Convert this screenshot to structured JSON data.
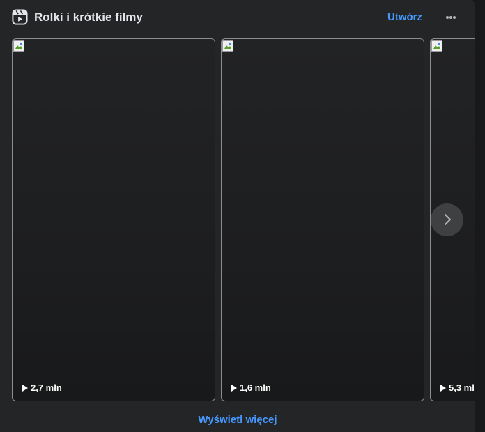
{
  "section": {
    "title": "Rolki i krótkie filmy",
    "icon": "reels-icon",
    "create_label": "Utwórz",
    "more_icon": "more-options-icon",
    "see_more_label": "Wyświetl więcej",
    "next_icon": "chevron-right-icon"
  },
  "reels": [
    {
      "views": "2,7 mln"
    },
    {
      "views": "1,6 mln"
    },
    {
      "views": "5,3 mln"
    }
  ],
  "colors": {
    "background": "#242526",
    "accent": "#4599ff",
    "text": "#e4e6eb"
  }
}
